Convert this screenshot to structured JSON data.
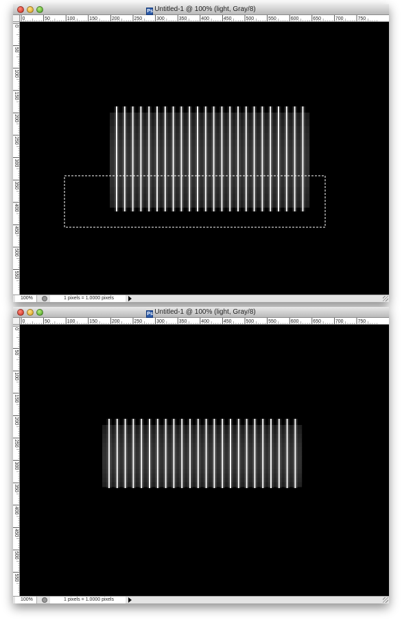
{
  "windows": [
    {
      "title": "Untitled-1 @ 100% (light, Gray/8)",
      "zoom": "100%",
      "status": "1 pixels = 1.0000 pixels",
      "has_selection": true
    },
    {
      "title": "Untitled-1 @ 100% (light, Gray/8)",
      "zoom": "100%",
      "status": "1 pixels = 1.0000 pixels",
      "has_selection": false
    }
  ],
  "ruler": {
    "h_labels": [
      "0",
      "50",
      "100",
      "150",
      "200",
      "250",
      "300",
      "350",
      "400",
      "450",
      "500",
      "550",
      "600",
      "650",
      "700",
      "750"
    ],
    "v_labels": [
      "0",
      "50",
      "100",
      "150",
      "200",
      "250",
      "300",
      "350",
      "400",
      "450",
      "500",
      "550"
    ]
  },
  "colors": {
    "canvas": "#000000",
    "stripe": "#ffffff",
    "selection": "#ffffff"
  },
  "icons": {
    "document": "photoshop-document-icon"
  }
}
